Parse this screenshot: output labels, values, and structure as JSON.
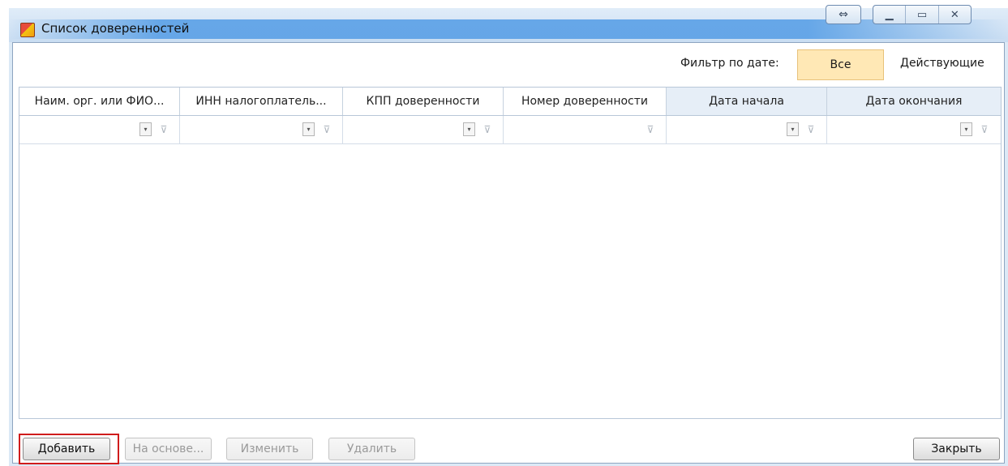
{
  "window": {
    "title": "Список доверенностей",
    "controls": {
      "resize": "⇔",
      "minimize": "▁",
      "maximize": "▭",
      "close": "✕"
    }
  },
  "filter": {
    "label": "Фильтр по дате:",
    "all": "Все",
    "active": "Действующие"
  },
  "grid": {
    "columns": [
      "Наим. орг. или ФИО...",
      "ИНН налогоплатель...",
      "КПП доверенности",
      "Номер доверенности",
      "Дата начала",
      "Дата окончания"
    ],
    "filter_icons": {
      "dropdown": "▾",
      "clear_filter": "⊽"
    }
  },
  "buttons": {
    "add": "Добавить",
    "based_on": "На основе...",
    "edit": "Изменить",
    "delete": "Удалить",
    "close": "Закрыть"
  },
  "colors": {
    "selected_filter_bg": "#ffe8b5",
    "highlight_border": "#d01c1c"
  }
}
